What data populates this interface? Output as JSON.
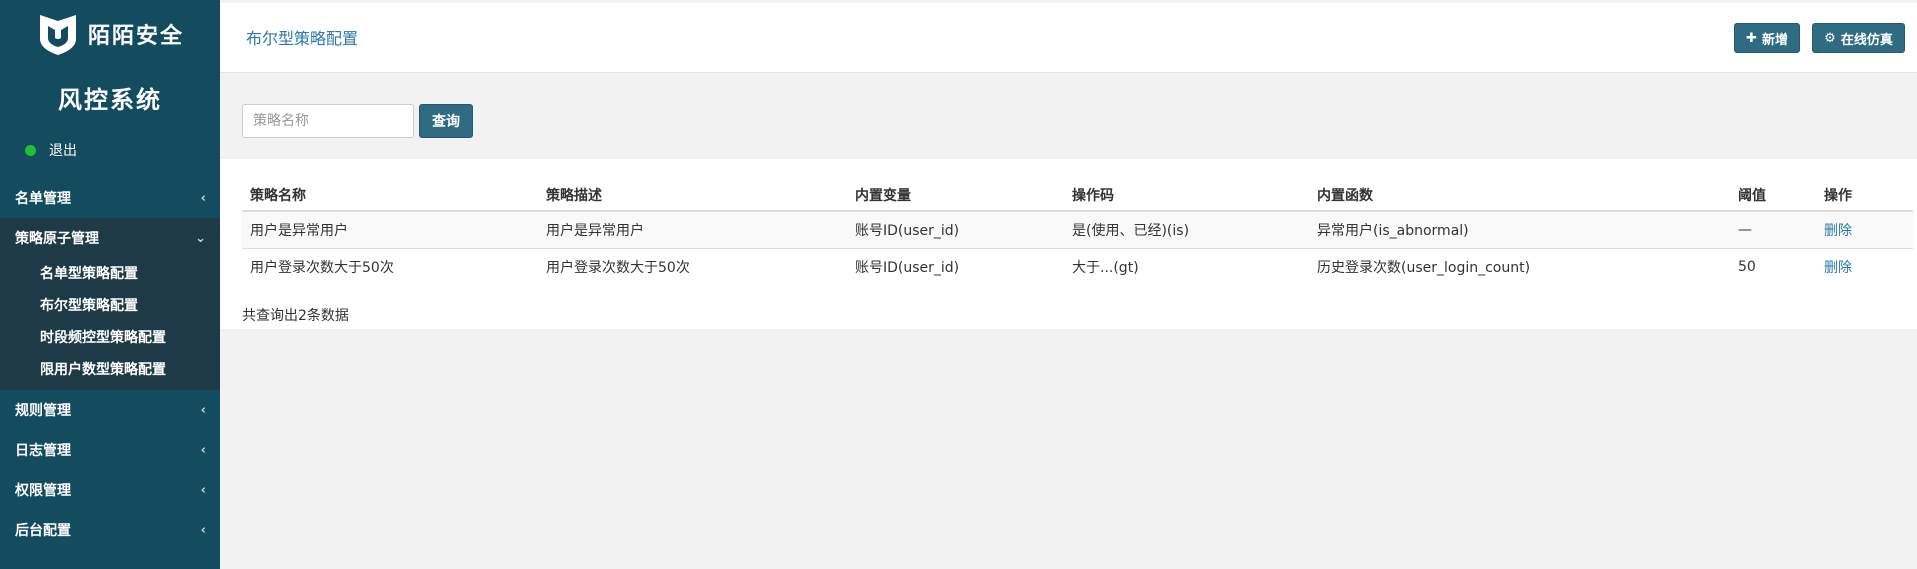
{
  "brand": {
    "name": "陌陌安全",
    "logo_icon": "shield-icon"
  },
  "system_title": "风控系统",
  "logout": {
    "label": "退出",
    "status_color": "#1fc12f"
  },
  "menu": [
    {
      "label": "名单管理",
      "open": false
    },
    {
      "label": "策略原子管理",
      "open": true,
      "items": [
        "名单型策略配置",
        "布尔型策略配置",
        "时段频控型策略配置",
        "限用户数型策略配置"
      ]
    },
    {
      "label": "规则管理",
      "open": false
    },
    {
      "label": "日志管理",
      "open": false
    },
    {
      "label": "权限管理",
      "open": false
    },
    {
      "label": "后台配置",
      "open": false
    }
  ],
  "header": {
    "title": "布尔型策略配置",
    "add_label": "新增",
    "sim_label": "在线仿真"
  },
  "search": {
    "placeholder": "策略名称",
    "value": "",
    "button_label": "查询"
  },
  "table": {
    "columns": [
      "策略名称",
      "策略描述",
      "内置变量",
      "操作码",
      "内置函数",
      "阈值",
      "操作"
    ],
    "rows": [
      [
        "用户是异常用户",
        "用户是异常用户",
        "账号ID(user_id)",
        "是(使用、已经)(is)",
        "异常用户(is_abnormal)",
        "—",
        "删除"
      ],
      [
        "用户登录次数大于50次",
        "用户登录次数大于50次",
        "账号ID(user_id)",
        "大于...(gt)",
        "历史登录次数(user_login_count)",
        "50",
        "删除"
      ]
    ]
  },
  "footer_count": "共查询出2条数据",
  "colors": {
    "sidebar": "#134b5f",
    "submenu": "#1e3a46",
    "accent": "#2f6b81",
    "link": "#2b7aab"
  }
}
